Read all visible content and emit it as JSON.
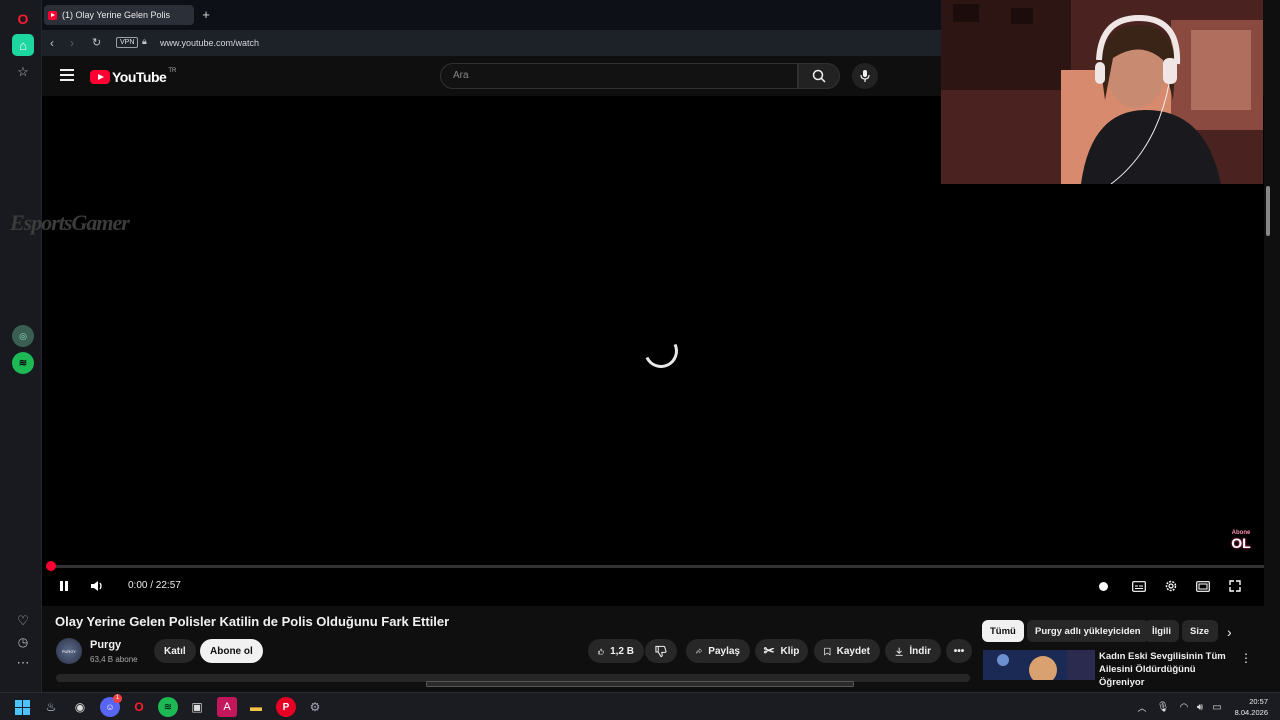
{
  "browser": {
    "tab_title": "(1) Olay Yerine Gelen Polis",
    "url": "www.youtube.com/watch",
    "vpn_badge": "VPN"
  },
  "youtube": {
    "logo_text": "YouTube",
    "region": "TR",
    "search_placeholder": "Ara"
  },
  "player": {
    "overlay_watermark": "EsportsGamer",
    "subscribe_overlay_small": "Abone",
    "subscribe_overlay_big": "OL",
    "time_display": "0:00 / 22:57",
    "progress_fraction": 0.0
  },
  "video": {
    "title": "Olay Yerine Gelen Polisler Katilin de Polis Olduğunu Fark Ettiler",
    "channel_name": "Purgy",
    "channel_avatar_text": "PURGY",
    "subscriber_count": "63,4 B abone",
    "join_label": "Katıl",
    "subscribe_label": "Abone ol",
    "like_count": "1,2 B",
    "share_label": "Paylaş",
    "clip_label": "Klip",
    "save_label": "Kaydet",
    "download_label": "İndir"
  },
  "chips": [
    "Tümü",
    "Purgy adlı yükleyiciden",
    "İlgili",
    "Size"
  ],
  "recommendation": {
    "title": "Kadın Eski Sevgilisinin Tüm Ailesini Öldürdüğünü Öğreniyor"
  },
  "taskbar": {
    "time": "20:57",
    "date": "8.04.2026",
    "discord_badge": "1"
  },
  "colors": {
    "youtube_red": "#ff0033",
    "background": "#0f0f0f",
    "opera_red": "#ff1b2d"
  }
}
